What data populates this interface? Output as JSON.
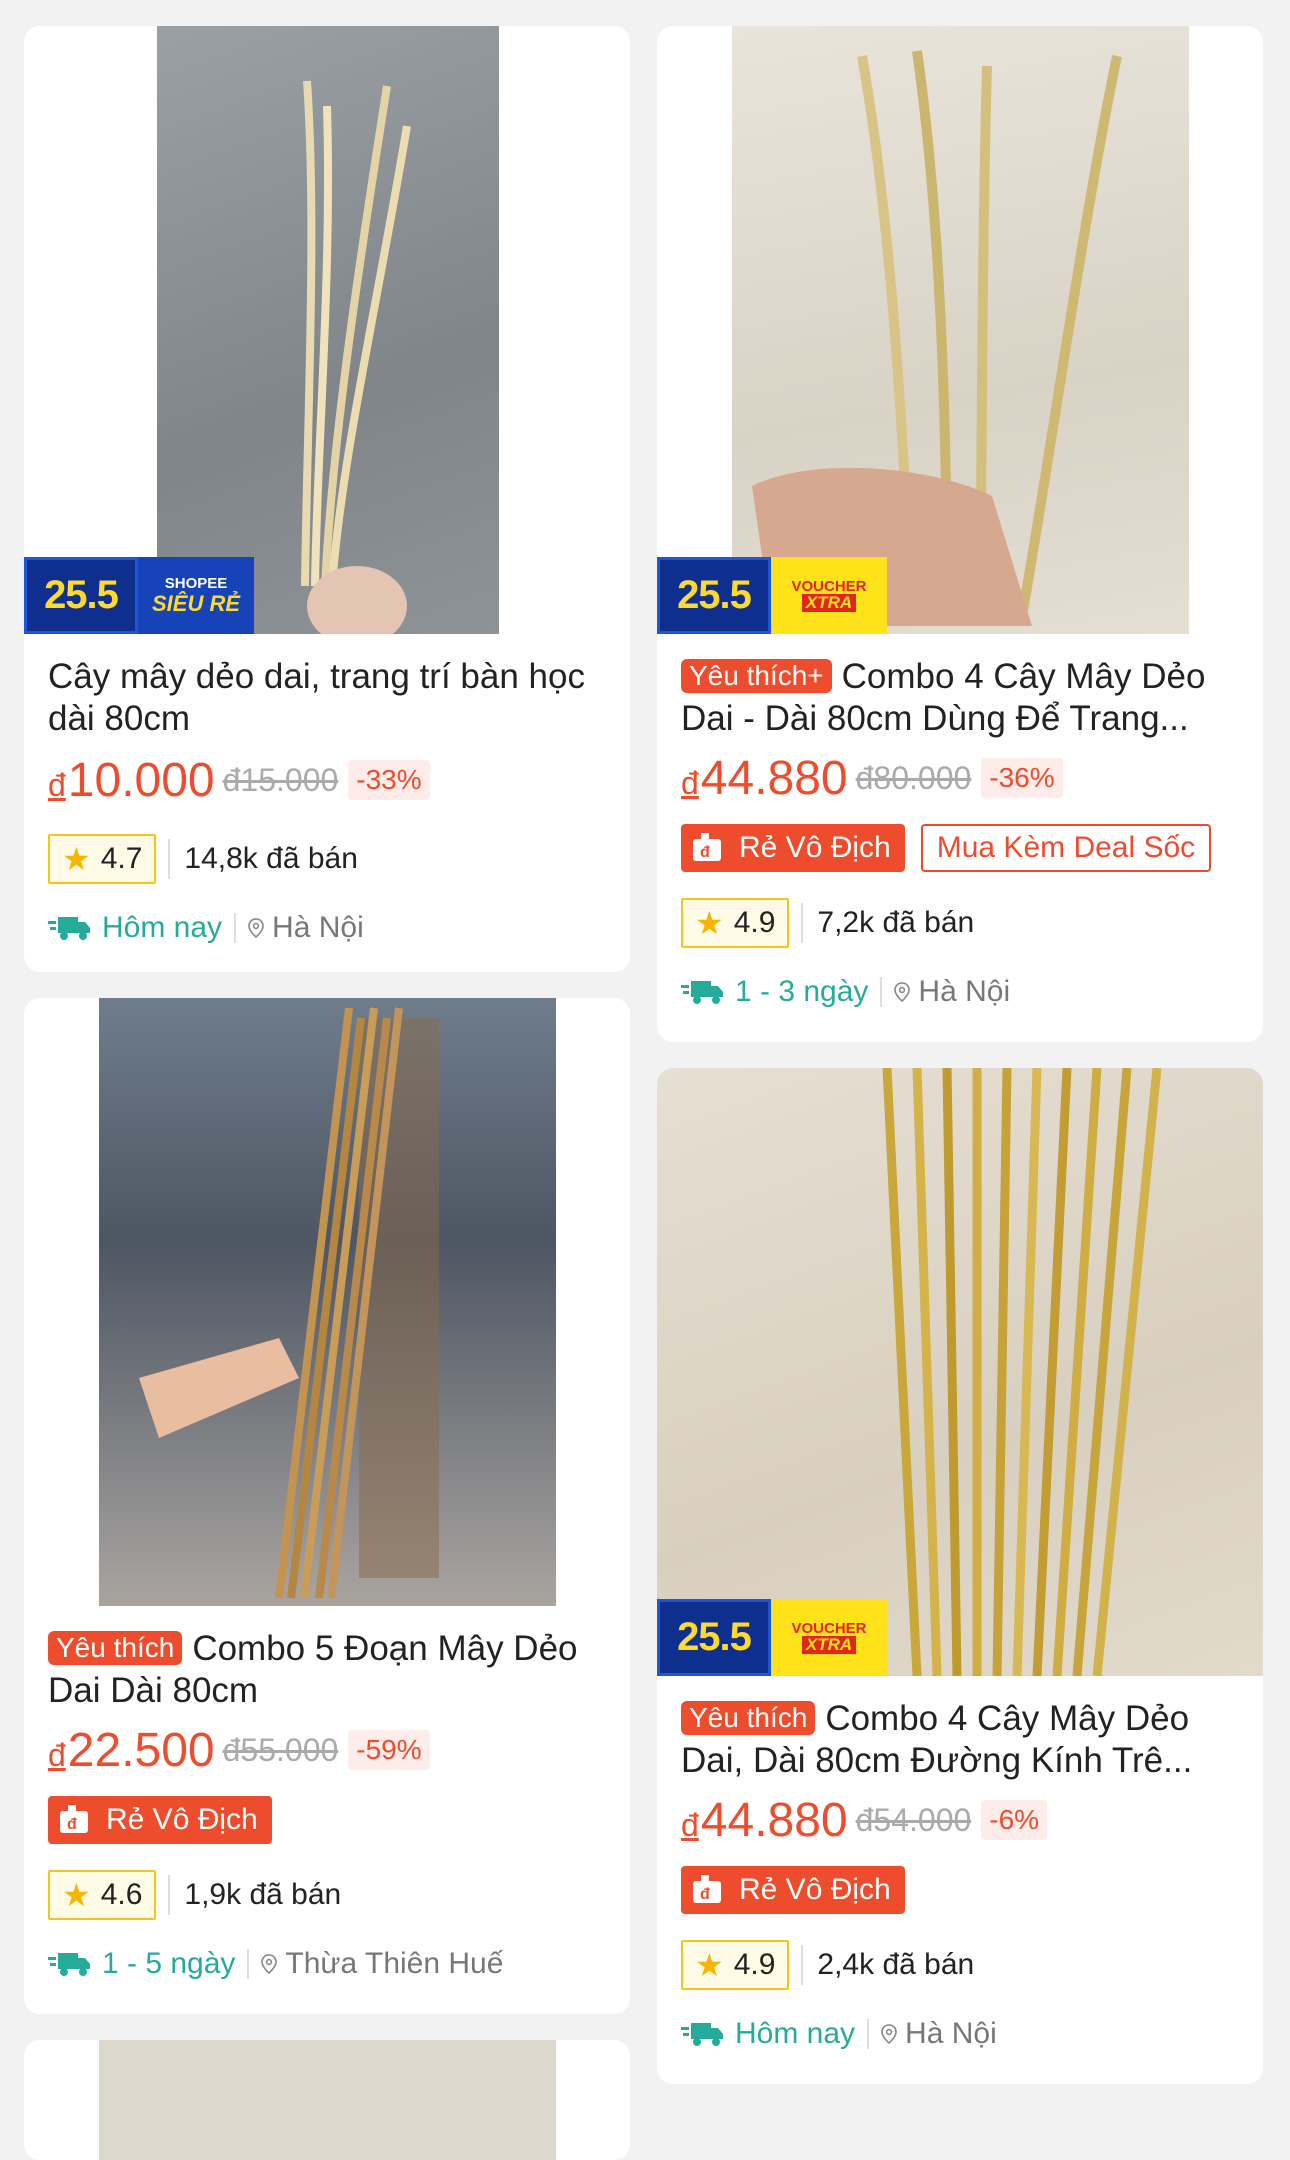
{
  "products": [
    {
      "title": "Cây mây dẻo dai, trang trí bàn học dài 80cm",
      "fav": "",
      "badge_date": "25.5",
      "badge_l1": "SHOPEE",
      "badge_l2": "SIÊU RẺ",
      "price_cur": "đ",
      "price": "10.000",
      "old_price": "đ15.000",
      "discount": "-33%",
      "tag_main": "",
      "tag_extra": "",
      "rating": "4.7",
      "sold": "14,8k đã bán",
      "ship": "Hôm nay",
      "location": "Hà Nội"
    },
    {
      "title": "Combo 4 Cây Mây Dẻo Dai - Dài 80cm Dùng Để Trang...",
      "fav": "Yêu thích+",
      "badge_date": "25.5",
      "badge_l1": "VOUCHER",
      "badge_l2": "XTRA",
      "price_cur": "đ",
      "price": "44.880",
      "old_price": "đ80.000",
      "discount": "-36%",
      "tag_main": "Rẻ Vô Địch",
      "tag_extra": "Mua Kèm Deal Sốc",
      "rating": "4.9",
      "sold": "7,2k đã bán",
      "ship": "1 - 3 ngày",
      "location": "Hà Nội"
    },
    {
      "title": "Combo 5 Đoạn Mây Dẻo Dai Dài 80cm",
      "fav": "Yêu thích",
      "price_cur": "đ",
      "price": "22.500",
      "old_price": "đ55.000",
      "discount": "-59%",
      "tag_main": "Rẻ Vô Địch",
      "rating": "4.6",
      "sold": "1,9k đã bán",
      "ship": "1 - 5 ngày",
      "location": "Thừa Thiên Huế"
    },
    {
      "title": "Combo 4 Cây Mây Dẻo Dai, Dài 80cm Đường Kính Trê...",
      "fav": "Yêu thích",
      "badge_date": "25.5",
      "badge_l1": "VOUCHER",
      "badge_l2": "XTRA",
      "price_cur": "đ",
      "price": "44.880",
      "old_price": "đ54.000",
      "discount": "-6%",
      "tag_main": "Rẻ Vô Địch",
      "rating": "4.9",
      "sold": "2,4k đã bán",
      "ship": "Hôm nay",
      "location": "Hà Nội"
    }
  ],
  "colors": {
    "accent": "#ee4d2d",
    "ship": "#26aa99",
    "star": "#f7b500"
  }
}
